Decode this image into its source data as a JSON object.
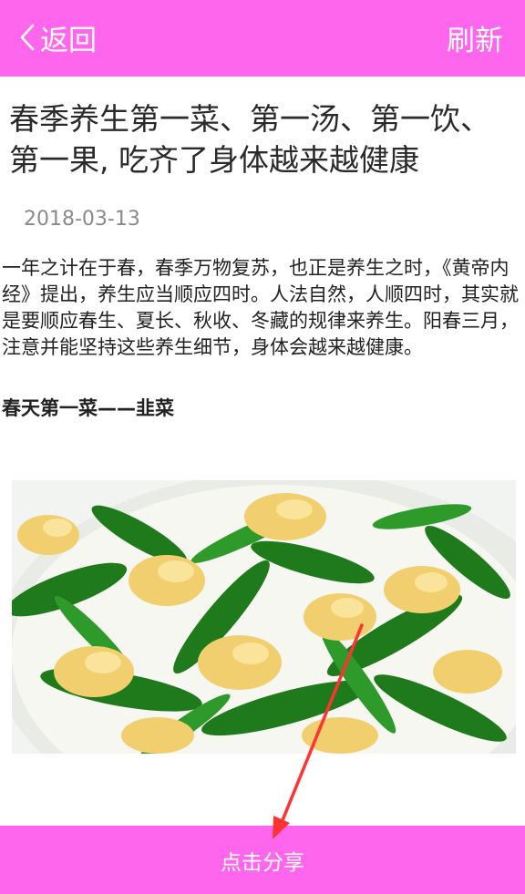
{
  "header": {
    "back_label": "返回",
    "refresh_label": "刷新",
    "bg_color": "#ff66ee",
    "back_icon": "chevron-left-icon"
  },
  "article": {
    "title": "春季养生第一菜、第一汤、第一饮、第一果, 吃齐了身体越来越健康",
    "date": "2018-03-13",
    "paragraph": "一年之计在于春，春季万物复苏，也正是养生之时，《黄帝内经》提出，养生应当顺应四时。人法自然，人顺四时，其实就是要顺应春生、夏长、秋收、冬藏的规律来养生。阳春三月，注意并能坚持这些养生细节，身体会越来越健康。",
    "subheading": "春天第一菜——韭菜",
    "photo": "chive-egg-dish-photo"
  },
  "footer": {
    "share_label": "点击分享"
  },
  "annotation": {
    "color": "#ff3333",
    "shape": "arrow-pointing-to-share-button"
  }
}
